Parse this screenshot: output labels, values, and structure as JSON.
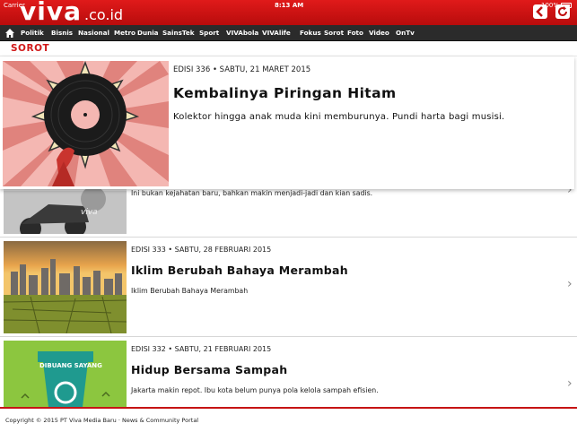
{
  "status_bar": {
    "carrier": "Carrier",
    "time": "8:13 AM",
    "battery": "100%"
  },
  "header": {
    "logo_main": "viva",
    "logo_tld": ".co.id",
    "back_icon": "back-arrow-icon",
    "refresh_icon": "refresh-icon",
    "accent_color": "#d01818"
  },
  "nav": {
    "home_icon": "home-icon",
    "items": [
      "Politik",
      "Bisnis",
      "Nasional",
      "Metro",
      "Dunia",
      "SainsTek",
      "Sport",
      "VIVAbola",
      "VIVAlife",
      "Fokus",
      "Sorot",
      "Foto",
      "Video",
      "OnTv"
    ]
  },
  "section": {
    "title": "SOROT"
  },
  "featured": {
    "edition": "EDISI 336 • SABTU, 21 MARET 2015",
    "title": "Kembalinya Piringan Hitam",
    "description": "Kolektor hingga anak muda kini memburunya. Pundi harta bagi musisi."
  },
  "articles": [
    {
      "edition": "",
      "title": "",
      "description": "Ini bukan kejahatan baru, bahkan makin menjadi-jadi dan kian sadis.",
      "image_caption": "viva"
    },
    {
      "edition": "EDISI 333 • SABTU, 28 FEBRUARI 2015",
      "title": "Iklim Berubah Bahaya Merambah",
      "description": "Iklim Berubah Bahaya Merambah"
    },
    {
      "edition": "EDISI 332 • SABTU, 21 FEBRUARI 2015",
      "title": "Hidup Bersama Sampah",
      "description": "Jakarta makin repot. Ibu kota belum punya pola kelola sampah efisien.",
      "image_caption": "DIBUANG SAYANG"
    }
  ],
  "footer": {
    "text": "Copyright © 2015 PT Viva Media Baru · News & Community Portal"
  }
}
